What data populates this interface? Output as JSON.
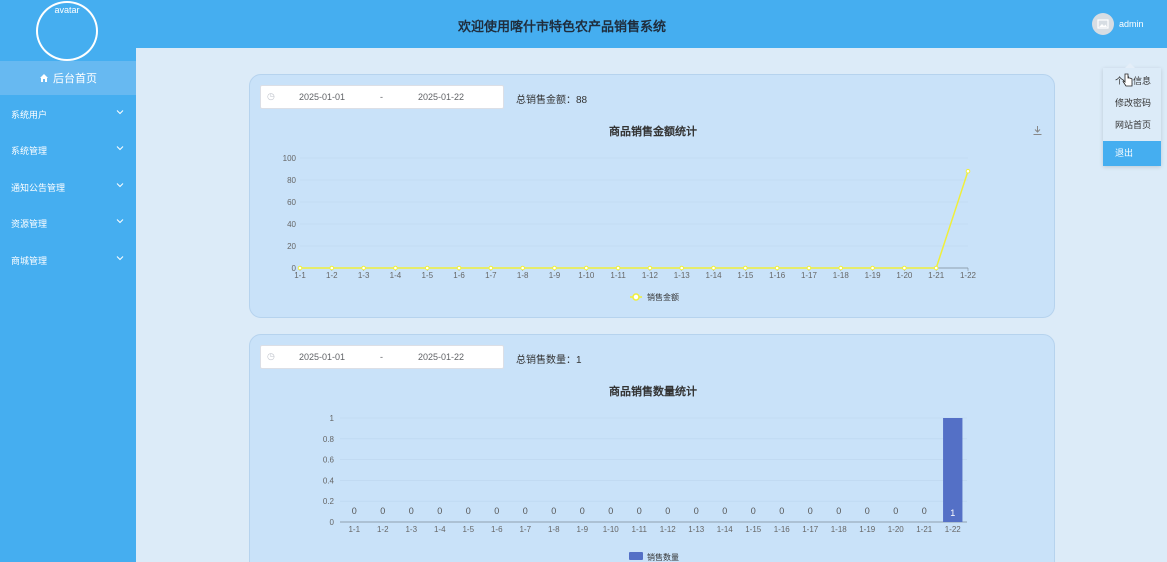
{
  "app": {
    "title": "欢迎使用喀什市特色农产品销售系统",
    "avatar_text": "avatar",
    "user": "admin"
  },
  "sidebar": {
    "home": "后台首页",
    "items": [
      {
        "label": "系统用户"
      },
      {
        "label": "系统管理"
      },
      {
        "label": "通知公告管理"
      },
      {
        "label": "资源管理"
      },
      {
        "label": "商城管理"
      }
    ]
  },
  "dropdown": {
    "items": [
      "个人信息",
      "修改密码",
      "网站首页",
      "退出"
    ]
  },
  "sales_amount": {
    "start_date": "2025-01-01",
    "separator": "-",
    "end_date": "2025-01-22",
    "total_label": "总销售金额：",
    "total_value": "88",
    "chart_title": "商品销售金额统计"
  },
  "sales_qty": {
    "start_date": "2025-01-01",
    "separator": "-",
    "end_date": "2025-01-22",
    "total_label": "总销售数量：",
    "total_value": "1",
    "chart_title": "商品销售数量统计"
  },
  "chart_data": [
    {
      "type": "line",
      "title": "商品销售金额统计",
      "categories": [
        "1-1",
        "1-2",
        "1-3",
        "1-4",
        "1-5",
        "1-6",
        "1-7",
        "1-8",
        "1-9",
        "1-10",
        "1-11",
        "1-12",
        "1-13",
        "1-14",
        "1-15",
        "1-16",
        "1-17",
        "1-18",
        "1-19",
        "1-20",
        "1-21",
        "1-22"
      ],
      "series": [
        {
          "name": "销售金额",
          "values": [
            0,
            0,
            0,
            0,
            0,
            0,
            0,
            0,
            0,
            0,
            0,
            0,
            0,
            0,
            0,
            0,
            0,
            0,
            0,
            0,
            0,
            88
          ]
        }
      ],
      "ylim": [
        0,
        100
      ],
      "yticks": [
        0,
        20,
        40,
        60,
        80,
        100
      ],
      "color": "#f0ef3a",
      "legend": "bottom-center"
    },
    {
      "type": "bar",
      "title": "商品销售数量统计",
      "categories": [
        "1-1",
        "1-2",
        "1-3",
        "1-4",
        "1-5",
        "1-6",
        "1-7",
        "1-8",
        "1-9",
        "1-10",
        "1-11",
        "1-12",
        "1-13",
        "1-14",
        "1-15",
        "1-16",
        "1-17",
        "1-18",
        "1-19",
        "1-20",
        "1-21",
        "1-22"
      ],
      "series": [
        {
          "name": "销售数量",
          "values": [
            0,
            0,
            0,
            0,
            0,
            0,
            0,
            0,
            0,
            0,
            0,
            0,
            0,
            0,
            0,
            0,
            0,
            0,
            0,
            0,
            0,
            1
          ]
        }
      ],
      "ylim": [
        0,
        1
      ],
      "yticks": [
        0,
        0.2,
        0.4,
        0.6,
        0.8,
        1
      ],
      "color": "#5470c6",
      "legend": "bottom-center"
    }
  ]
}
